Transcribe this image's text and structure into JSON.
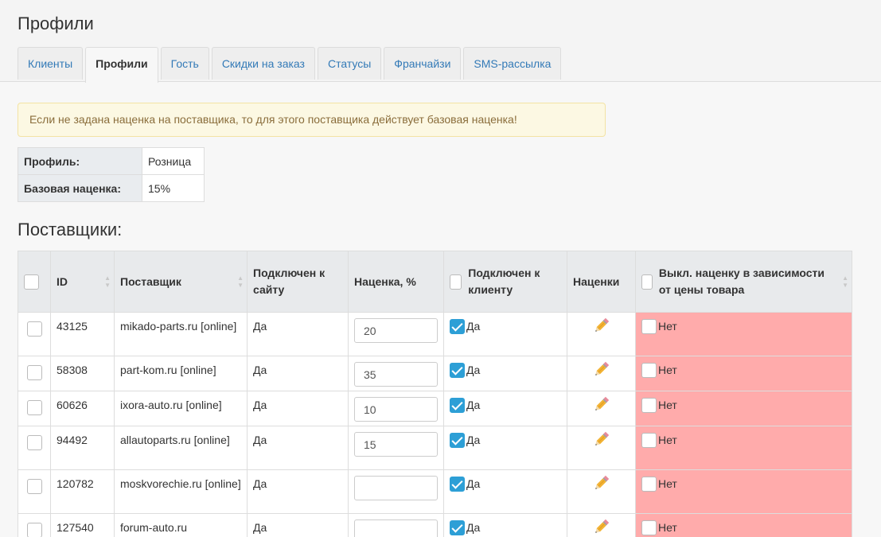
{
  "page": {
    "title": "Профили"
  },
  "tabs": [
    {
      "label": "Клиенты"
    },
    {
      "label": "Профили"
    },
    {
      "label": "Гость"
    },
    {
      "label": "Скидки на заказ"
    },
    {
      "label": "Статусы"
    },
    {
      "label": "Франчайзи"
    },
    {
      "label": "SMS-рассылка"
    }
  ],
  "active_tab": "Профили",
  "alert": {
    "text": "Если не задана наценка на поставщика, то для этого поставщика действует базовая наценка!"
  },
  "profile": {
    "profile_label": "Профиль:",
    "profile_value": "Розница",
    "markup_label": "Базовая наценка:",
    "markup_value": "15%"
  },
  "suppliers": {
    "title": "Поставщики:",
    "columns": {
      "id": "ID",
      "supplier": "Поставщик",
      "connected_site": "Подключен к сайту",
      "markup": "Наценка, %",
      "connected_client": "Подключен к клиенту",
      "markups": "Наценки",
      "disable_markup": "Выкл. наценку в зависимости от цены товара"
    },
    "rows": [
      {
        "id": "43125",
        "name": "mikado-parts.ru [online]",
        "site": "Да",
        "markup": "20",
        "client": "Да",
        "disable": "Нет"
      },
      {
        "id": "58308",
        "name": "part-kom.ru [online]",
        "site": "Да",
        "markup": "35",
        "client": "Да",
        "disable": "Нет"
      },
      {
        "id": "60626",
        "name": "ixora-auto.ru [online]",
        "site": "Да",
        "markup": "10",
        "client": "Да",
        "disable": "Нет"
      },
      {
        "id": "94492",
        "name": "allautoparts.ru [online]",
        "site": "Да",
        "markup": "15",
        "client": "Да",
        "disable": "Нет"
      },
      {
        "id": "120782",
        "name": "moskvorechie.ru [online]",
        "site": "Да",
        "markup": "",
        "client": "Да",
        "disable": "Нет"
      },
      {
        "id": "127540",
        "name": "forum-auto.ru",
        "site": "Да",
        "markup": "",
        "client": "Да",
        "disable": "Нет"
      }
    ]
  },
  "colors": {
    "accent": "#337ab7",
    "checkbox_on": "#2d9fd6",
    "disabled_cell": "#ffabab",
    "alert_bg": "#fcf8e3"
  },
  "icons": {
    "edit": "pencil-icon",
    "sort": "sort-arrows-icon"
  }
}
